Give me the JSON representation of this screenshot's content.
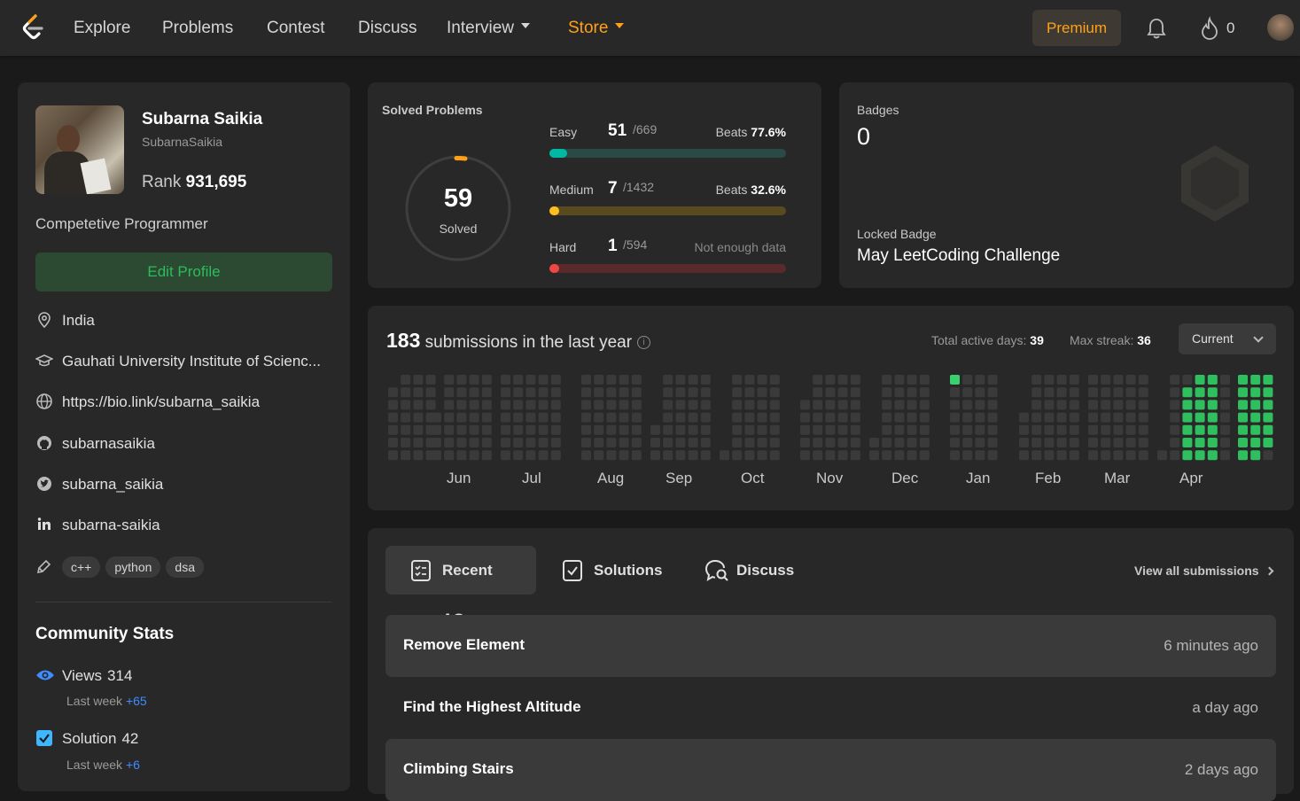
{
  "nav": {
    "items": [
      "Explore",
      "Problems",
      "Contest",
      "Discuss",
      "Interview",
      "Store"
    ],
    "premium": "Premium",
    "streak": "0",
    "colors": {
      "brand": "#ffa116",
      "bg": "#282828"
    }
  },
  "profile": {
    "name": "Subarna Saikia",
    "username": "SubarnaSaikia",
    "rank_label": "Rank",
    "rank": "931,695",
    "bio": "Competetive Programmer",
    "edit": "Edit Profile",
    "location": "India",
    "school": "Gauhati University Institute of Scienc...",
    "website": "https://bio.link/subarna_saikia",
    "github": "subarnasaikia",
    "twitter": "subarna_saikia",
    "linkedin": "subarna-saikia",
    "skills": [
      "c++",
      "python",
      "dsa"
    ],
    "icons": [
      "location-icon",
      "school-icon",
      "globe-icon",
      "github-icon",
      "twitter-icon",
      "linkedin-icon",
      "tag-icon"
    ]
  },
  "community": {
    "title": "Community Stats",
    "views_label": "Views",
    "views": "314",
    "views_week_label": "Last week",
    "views_week": "+65",
    "solution_label": "Solution",
    "solution": "42",
    "solution_week_label": "Last week",
    "solution_week": "+6"
  },
  "solved": {
    "title": "Solved Problems",
    "total": "59",
    "total_label": "Solved",
    "easy": {
      "label": "Easy",
      "num": "51",
      "total": "/669",
      "beats_label": "Beats",
      "beats": "77.6%",
      "progress": 0.076,
      "color": "#00b8a3",
      "track": "#2a4a45"
    },
    "medium": {
      "label": "Medium",
      "num": "7",
      "total": "/1432",
      "beats_label": "Beats",
      "beats": "32.6%",
      "progress": 0.005,
      "color": "#ffc01e",
      "track": "#5a4a20"
    },
    "hard": {
      "label": "Hard",
      "num": "1",
      "total": "/594",
      "note": "Not enough data",
      "progress": 0.002,
      "color": "#ef4743",
      "track": "#5a2a2a"
    }
  },
  "badges": {
    "label": "Badges",
    "count": "0",
    "locked_label": "Locked Badge",
    "locked_name": "May LeetCoding Challenge"
  },
  "submissions": {
    "count": "183",
    "text": "submissions in the last year",
    "active_label": "Total active days:",
    "active": "39",
    "streak_label": "Max streak:",
    "streak": "36",
    "period": "Current",
    "months": [
      "Jun",
      "Jul",
      "Aug",
      "Sep",
      "Oct",
      "Nov",
      "Dec",
      "Jan",
      "Feb",
      "Mar",
      "Apr"
    ]
  },
  "tabs": {
    "recent": "Recent AC",
    "solutions": "Solutions",
    "discuss": "Discuss",
    "view_all": "View all submissions"
  },
  "recent": [
    {
      "title": "Remove Element",
      "time": "6 minutes ago"
    },
    {
      "title": "Find the Highest Altitude",
      "time": "a day ago"
    },
    {
      "title": "Climbing Stairs",
      "time": "2 days ago"
    }
  ]
}
